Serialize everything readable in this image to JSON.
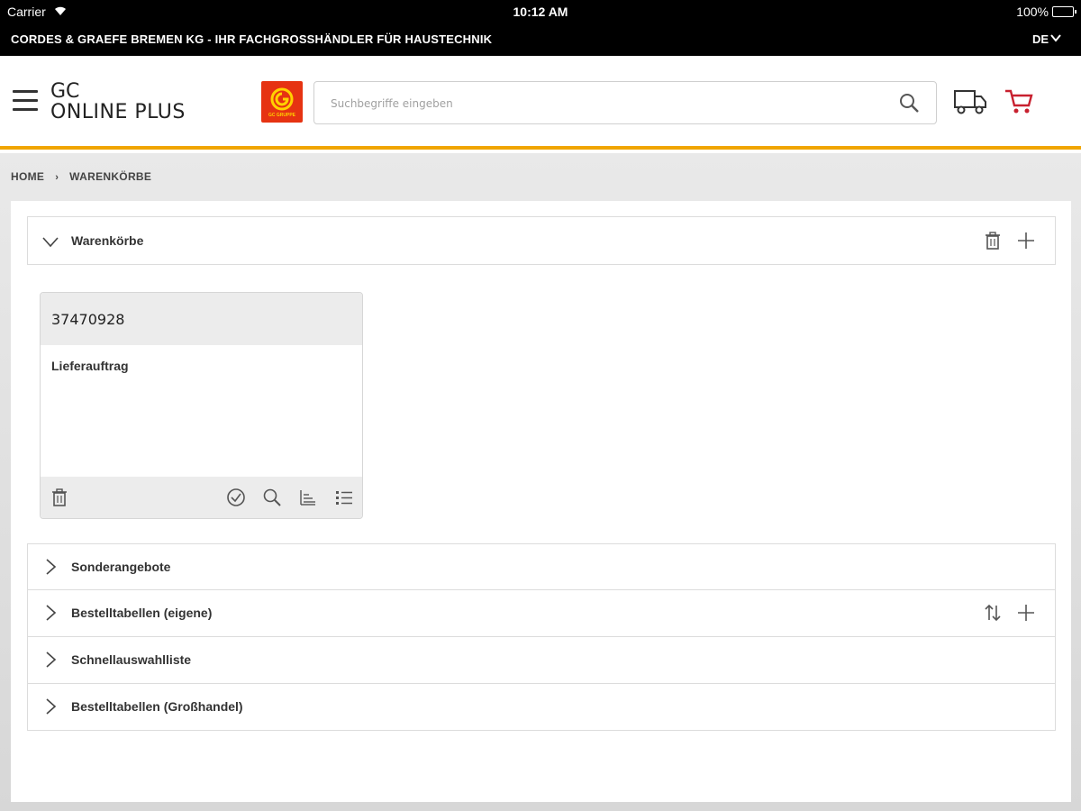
{
  "status_bar": {
    "carrier": "Carrier",
    "time": "10:12 AM",
    "battery": "100%"
  },
  "company_bar": {
    "company": "CORDES & GRAEFE BREMEN KG - IHR FACHGROSSHÄNDLER FÜR HAUSTECHNIK",
    "language": "DE"
  },
  "header": {
    "brand_line1": "GC",
    "brand_line2": "ONLINE PLUS",
    "logo_text": "GC GRUPPE",
    "search_placeholder": "Suchbegriffe eingeben",
    "accent_color": "#f0a500",
    "cart_color": "#c8202f"
  },
  "breadcrumb": {
    "items": [
      "HOME",
      "WARENKÖRBE"
    ]
  },
  "warenkoerbe": {
    "label": "Warenkörbe",
    "expanded": true,
    "carts": [
      {
        "id": "37470928",
        "type": "Lieferauftrag"
      }
    ]
  },
  "sections": [
    {
      "label": "Sonderangebote"
    },
    {
      "label": "Bestelltabellen (eigene)"
    },
    {
      "label": "Schnellauswahlliste"
    },
    {
      "label": "Bestelltabellen (Großhandel)"
    }
  ]
}
